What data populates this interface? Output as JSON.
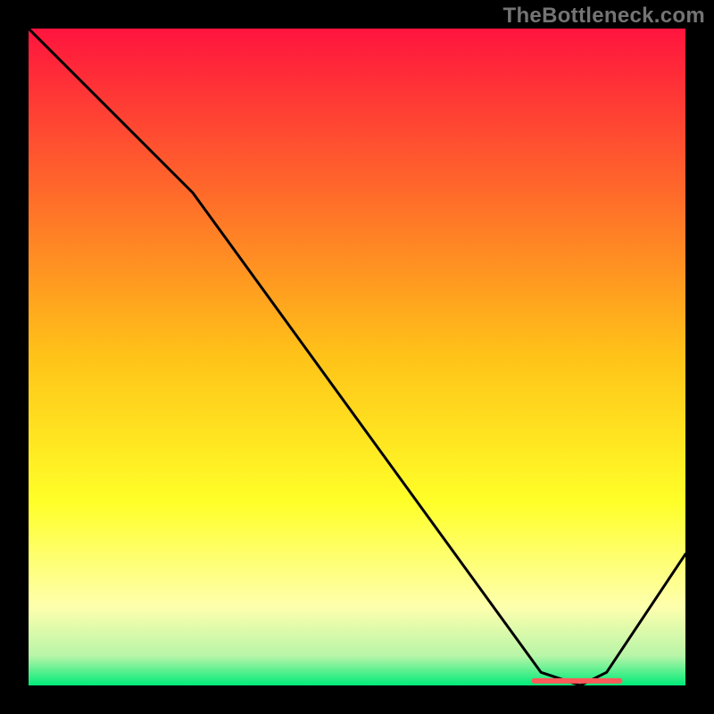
{
  "watermark": "TheBottleneck.com",
  "chart_data": {
    "type": "line",
    "title": "",
    "xlabel": "",
    "ylabel": "",
    "xlim": [
      0,
      100
    ],
    "ylim": [
      0,
      100
    ],
    "grid": false,
    "legend": false,
    "background_gradient": {
      "stops": [
        {
          "offset": 0.0,
          "color": "#ff143e"
        },
        {
          "offset": 0.25,
          "color": "#ff6a2a"
        },
        {
          "offset": 0.5,
          "color": "#ffc318"
        },
        {
          "offset": 0.72,
          "color": "#ffff28"
        },
        {
          "offset": 0.88,
          "color": "#feffad"
        },
        {
          "offset": 0.955,
          "color": "#b8f5a8"
        },
        {
          "offset": 1.0,
          "color": "#00eb79"
        }
      ]
    },
    "series": [
      {
        "name": "curve",
        "color": "#000000",
        "x": [
          0,
          25,
          78,
          84,
          88,
          100
        ],
        "y": [
          100,
          75,
          2,
          0,
          2,
          20
        ]
      }
    ],
    "marker": {
      "name": "min-region",
      "color": "#ff5a5a",
      "x_start": 77,
      "x_end": 90,
      "y": 0.7,
      "thickness": 1.2
    }
  }
}
